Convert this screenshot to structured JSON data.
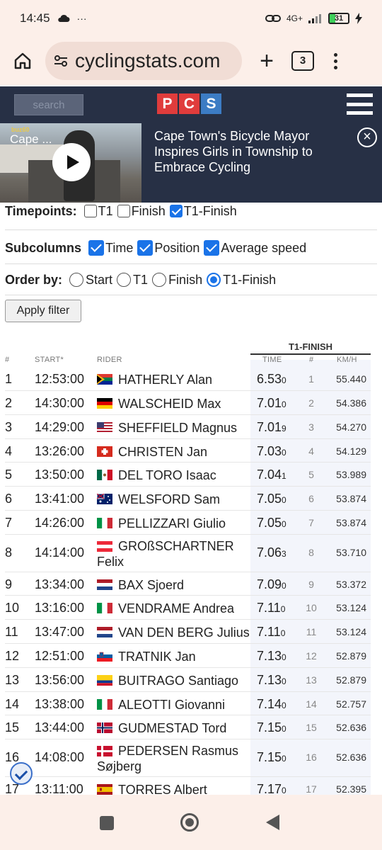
{
  "status_bar": {
    "time": "14:45",
    "extra": "···",
    "network": "4G+",
    "battery": "31"
  },
  "browser": {
    "url": "cyclingstats.com",
    "tab_count": "3"
  },
  "site": {
    "search_placeholder": "search",
    "logo": [
      "P",
      "C",
      "S"
    ]
  },
  "ad": {
    "video_title": "Cape ...",
    "video_brand": "buz60",
    "headline": "Cape Town's Bicycle Mayor Inspires Girls in Township to Embrace Cycling",
    "close": "×"
  },
  "filters": {
    "timepoints_label": "Timepoints:",
    "timepoints": [
      {
        "label": "T1",
        "checked": false
      },
      {
        "label": "Finish",
        "checked": false
      },
      {
        "label": "T1-Finish",
        "checked": true
      }
    ],
    "subcolumns_label": "Subcolumns",
    "subcolumns": [
      {
        "label": "Time",
        "checked": true
      },
      {
        "label": "Position",
        "checked": true
      },
      {
        "label": "Average speed",
        "checked": true
      }
    ],
    "order_label": "Order by:",
    "order_options": [
      {
        "label": "Start",
        "selected": false
      },
      {
        "label": "T1",
        "selected": false
      },
      {
        "label": "Finish",
        "selected": false
      },
      {
        "label": "T1-Finish",
        "selected": true
      }
    ],
    "apply_label": "Apply filter"
  },
  "table": {
    "group_header": "T1-FINISH",
    "headers": {
      "num": "#",
      "start": "START*",
      "rider": "RIDER",
      "time": "TIME",
      "pos": "#",
      "kmh": "KM/H"
    },
    "rows": [
      {
        "num": "1",
        "start": "12:53:00",
        "flag": "za",
        "rider": "HATHERLY Alan",
        "time": "6.53",
        "dec": "0",
        "pos": "1",
        "kmh": "55.440"
      },
      {
        "num": "2",
        "start": "14:30:00",
        "flag": "de",
        "rider": "WALSCHEID Max",
        "time": "7.01",
        "dec": "0",
        "pos": "2",
        "kmh": "54.386"
      },
      {
        "num": "3",
        "start": "14:29:00",
        "flag": "us",
        "rider": "SHEFFIELD Magnus",
        "time": "7.01",
        "dec": "9",
        "pos": "3",
        "kmh": "54.270"
      },
      {
        "num": "4",
        "start": "13:26:00",
        "flag": "ch",
        "rider": "CHRISTEN Jan",
        "time": "7.03",
        "dec": "0",
        "pos": "4",
        "kmh": "54.129"
      },
      {
        "num": "5",
        "start": "13:50:00",
        "flag": "mx",
        "rider": "DEL TORO Isaac",
        "time": "7.04",
        "dec": "1",
        "pos": "5",
        "kmh": "53.989"
      },
      {
        "num": "6",
        "start": "13:41:00",
        "flag": "au",
        "rider": "WELSFORD Sam",
        "time": "7.05",
        "dec": "0",
        "pos": "6",
        "kmh": "53.874"
      },
      {
        "num": "7",
        "start": "14:26:00",
        "flag": "it",
        "rider": "PELLIZZARI Giulio",
        "time": "7.05",
        "dec": "0",
        "pos": "7",
        "kmh": "53.874"
      },
      {
        "num": "8",
        "start": "14:14:00",
        "flag": "at",
        "rider": "GROßSCHARTNER",
        "rider2": "Felix",
        "time": "7.06",
        "dec": "3",
        "pos": "8",
        "kmh": "53.710"
      },
      {
        "num": "9",
        "start": "13:34:00",
        "flag": "nl",
        "rider": "BAX Sjoerd",
        "time": "7.09",
        "dec": "0",
        "pos": "9",
        "kmh": "53.372"
      },
      {
        "num": "10",
        "start": "13:16:00",
        "flag": "it",
        "rider": "VENDRAME Andrea",
        "time": "7.11",
        "dec": "0",
        "pos": "10",
        "kmh": "53.124"
      },
      {
        "num": "11",
        "start": "13:47:00",
        "flag": "nl",
        "rider": "VAN DEN BERG Julius",
        "time": "7.11",
        "dec": "0",
        "pos": "11",
        "kmh": "53.124"
      },
      {
        "num": "12",
        "start": "12:51:00",
        "flag": "si",
        "rider": "TRATNIK Jan",
        "time": "7.13",
        "dec": "0",
        "pos": "12",
        "kmh": "52.879"
      },
      {
        "num": "13",
        "start": "13:56:00",
        "flag": "co",
        "rider": "BUITRAGO Santiago",
        "time": "7.13",
        "dec": "0",
        "pos": "13",
        "kmh": "52.879"
      },
      {
        "num": "14",
        "start": "13:38:00",
        "flag": "it",
        "rider": "ALEOTTI Giovanni",
        "time": "7.14",
        "dec": "0",
        "pos": "14",
        "kmh": "52.757"
      },
      {
        "num": "15",
        "start": "13:44:00",
        "flag": "no",
        "rider": "GUDMESTAD Tord",
        "time": "7.15",
        "dec": "0",
        "pos": "15",
        "kmh": "52.636"
      },
      {
        "num": "16",
        "start": "14:08:00",
        "flag": "dk",
        "rider": "PEDERSEN Rasmus",
        "rider2": "Søjberg",
        "time": "7.15",
        "dec": "0",
        "pos": "16",
        "kmh": "52.636"
      },
      {
        "num": "17",
        "start": "13:11:00",
        "flag": "es",
        "rider": "TORRES Albert",
        "time": "7.17",
        "dec": "0",
        "pos": "17",
        "kmh": "52.395"
      }
    ]
  }
}
